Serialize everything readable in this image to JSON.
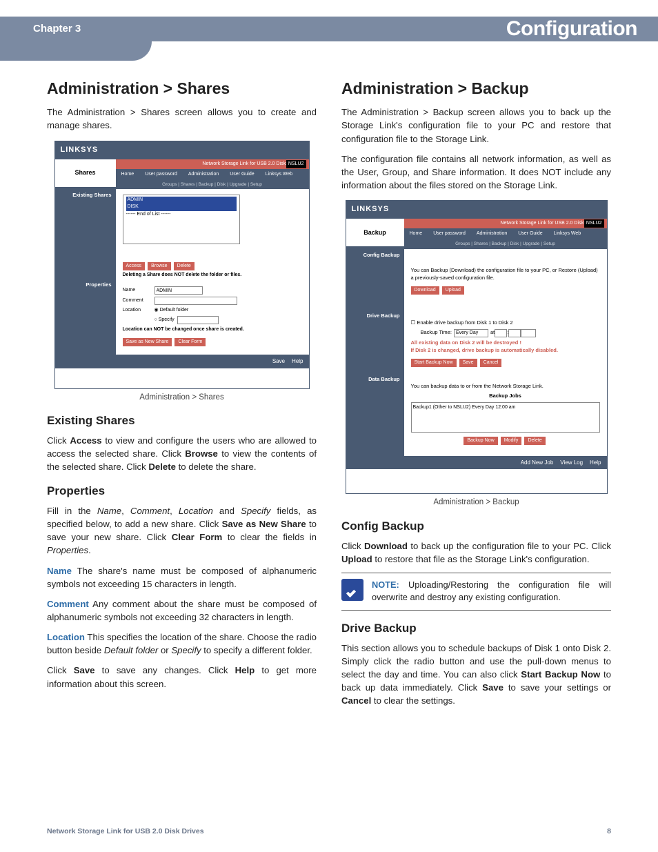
{
  "header": {
    "chapter": "Chapter 3",
    "title": "Configuration"
  },
  "left": {
    "h1": "Administration > Shares",
    "intro": "The Administration > Shares screen allows you to create and manage shares.",
    "figcap": "Administration > Shares",
    "existing_h": "Existing Shares",
    "existing_p": "Click Access to view and configure the users who are allowed to access the selected share. Click Browse to view the contents of the selected share. Click Delete to delete the share.",
    "props_h": "Properties",
    "props_p1": "Fill in the Name, Comment, Location and Specify fields, as specified below, to add a new share. Click Save as New Share to save your new share. Click Clear Form to clear the fields in Properties.",
    "name_lbl": "Name",
    "name_txt": " The share's name must be composed of alphanumeric symbols not exceeding 15 characters in length.",
    "comment_lbl": "Comment",
    "comment_txt": " Any comment about the share must be composed of alphanumeric symbols not exceeding 32 characters in length.",
    "location_lbl": "Location",
    "location_txt": " This specifies the location of the share. Choose the radio button beside Default folder or Specify to specify a different folder.",
    "save_help": "Click Save to save any changes. Click Help to get more information about this screen."
  },
  "right": {
    "h1": "Administration > Backup",
    "intro1": "The Administration > Backup screen allows you to back up the Storage Link's configuration file to your PC and restore that configuration file to the Storage Link.",
    "intro2": "The configuration file contains all network information, as well as the User, Group, and Share information. It does NOT include any information about the files stored on the Storage Link.",
    "figcap": "Administration > Backup",
    "config_h": "Config Backup",
    "config_p": "Click Download to back up the configuration file to your PC. Click Upload to restore that file as the Storage Link's configuration.",
    "note_label": "NOTE:",
    "note_text": " Uploading/Restoring the configuration file will overwrite and destroy any existing configuration.",
    "drive_h": "Drive Backup",
    "drive_p": "This section allows you to schedule backups of Disk 1 onto Disk 2. Simply click the radio button and use the pull-down menus to select the day and time. You can also click Start Backup Now to back up data immediately. Click Save to save your settings or Cancel to clear the settings."
  },
  "ss_shares": {
    "logo": "LINKSYS",
    "product": "Network Storage Link for USB 2.0 Disks",
    "model": "NSLU2",
    "section": "Shares",
    "tabs": [
      "Home",
      "User password",
      "Administration",
      "User Guide",
      "Linksys Web"
    ],
    "subtabs": "Groups | Shares | Backup | Disk | Upgrade | Setup",
    "side1": "Existing Shares",
    "list_sel1": "ADMIN",
    "list_sel2": "DISK",
    "list_end": "------ End of List ------",
    "btn_access": "Access",
    "btn_browse": "Browse",
    "btn_delete": "Delete",
    "note1": "Deleting a Share does NOT delete the folder or files.",
    "side2": "Properties",
    "f_name": "Name",
    "f_name_v": "ADMIN",
    "f_comment": "Comment",
    "f_location": "Location",
    "f_loc_opt1": "Default folder",
    "f_loc_opt2": "Specify",
    "note2": "Location can NOT be changed once share is created.",
    "btn_saveas": "Save as New Share",
    "btn_clear": "Clear Form",
    "foot_save": "Save",
    "foot_help": "Help"
  },
  "ss_backup": {
    "logo": "LINKSYS",
    "product": "Network Storage Link for USB 2.0 Disks",
    "model": "NSLU2",
    "section": "Backup",
    "tabs": [
      "Home",
      "User password",
      "Administration",
      "User Guide",
      "Linksys Web"
    ],
    "subtabs": "Groups | Shares | Backup | Disk | Upgrade | Setup",
    "side1": "Config Backup",
    "cfg_txt": "You can Backup (Download) the configuration file to your PC, or Restore (Upload) a previously-saved configuration file.",
    "btn_download": "Download",
    "btn_upload": "Upload",
    "side2": "Drive Backup",
    "drv_chk": "Enable drive backup from Disk 1 to Disk 2",
    "drv_time_lbl": "Backup Time:",
    "drv_time_val": "Every Day",
    "drv_warn1": "All existing data on Disk 2 will be destroyed !",
    "drv_warn2": "If Disk 2 is changed, drive backup is automatically disabled.",
    "btn_start": "Start Backup Now",
    "btn_save": "Save",
    "btn_cancel": "Cancel",
    "side3": "Data Backup",
    "data_txt": "You can backup data to or from the Network Storage Link.",
    "data_jobs": "Backup Jobs",
    "data_row": "Backup1 (Other to NSLU2) Every Day 12:00 am",
    "btn_bnow": "Backup Now",
    "btn_modify": "Modify",
    "btn_delete": "Delete",
    "foot_add": "Add New Job",
    "foot_log": "View Log",
    "foot_help": "Help"
  },
  "footer": {
    "left": "Network Storage Link for USB 2.0 Disk Drives",
    "right": "8"
  }
}
